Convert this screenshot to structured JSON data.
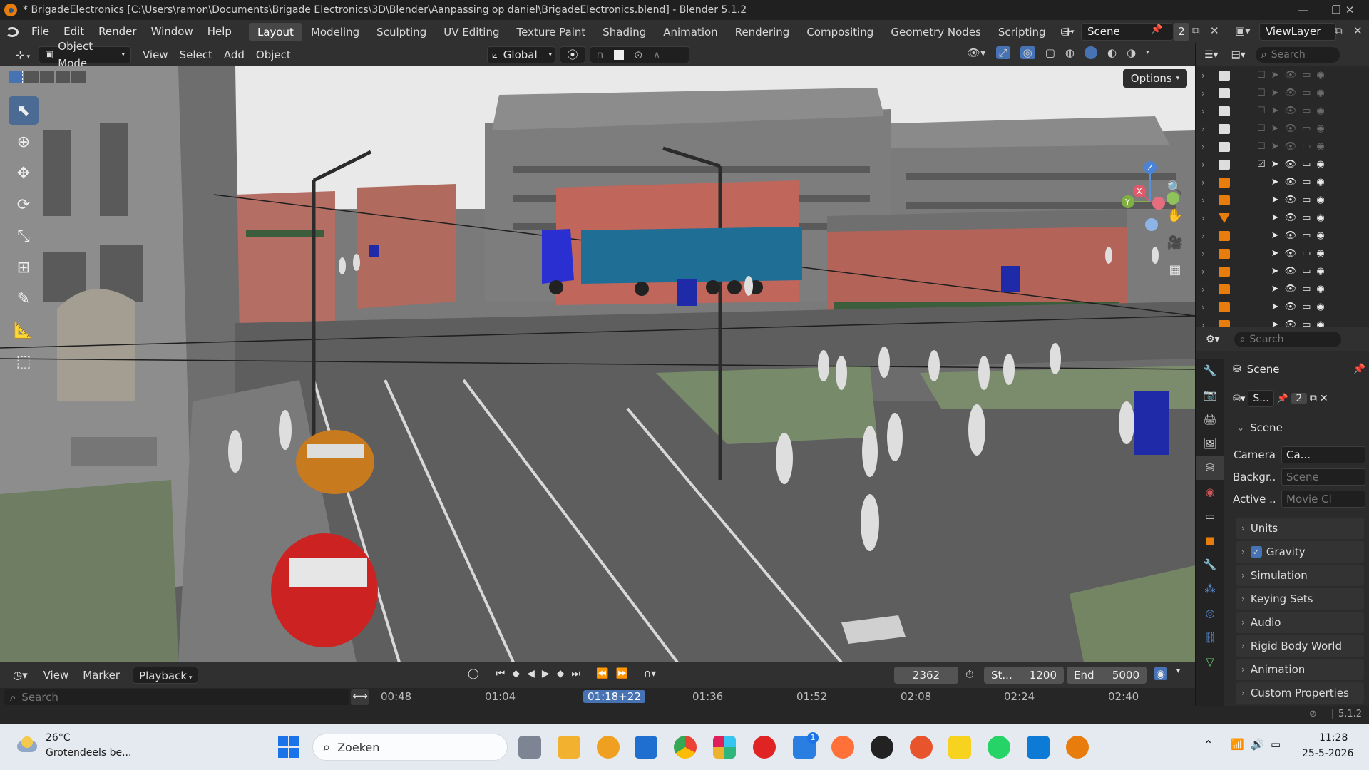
{
  "titlebar": {
    "title": "* BrigadeElectronics [C:\\Users\\ramon\\Documents\\Brigade Electronics\\3D\\Blender\\Aanpassing op daniel\\BrigadeElectronics.blend] - Blender 5.1.2",
    "minimize": "—",
    "maximize": "❐",
    "close": "✕"
  },
  "menubar": {
    "menus": [
      "File",
      "Edit",
      "Render",
      "Window",
      "Help"
    ],
    "workspaces": [
      "Layout",
      "Modeling",
      "Sculpting",
      "UV Editing",
      "Texture Paint",
      "Shading",
      "Animation",
      "Rendering",
      "Compositing",
      "Geometry Nodes",
      "Scripting"
    ],
    "active_workspace": "Layout",
    "add_workspace": "+",
    "scene_label": "Scene",
    "scene_users": "2",
    "viewlayer_label": "ViewLayer"
  },
  "viewport_header": {
    "mode": "Object Mode",
    "menus": [
      "View",
      "Select",
      "Add",
      "Object"
    ],
    "transform_orientation": "Global",
    "options_label": "Options"
  },
  "outliner": {
    "search_placeholder": "Search"
  },
  "properties": {
    "search_placeholder": "Search",
    "scene_title": "Scene",
    "scene_short": "S...",
    "scene_users": "2",
    "scene_panel": "Scene",
    "fields": [
      {
        "label": "Camera",
        "value": "Ca..."
      },
      {
        "label": "Backgr...",
        "value": "Scene"
      },
      {
        "label": "Active ...",
        "value": "Movie Cl"
      }
    ],
    "sections": [
      "Units",
      "Gravity",
      "Simulation",
      "Keying Sets",
      "Audio",
      "Rigid Body World",
      "Animation",
      "Custom Properties"
    ],
    "gravity_checked": true
  },
  "timeline": {
    "menus": [
      "View",
      "Marker"
    ],
    "playback": "Playback",
    "current_frame": "2362",
    "start_label": "St...",
    "start_value": "1200",
    "end_label": "End",
    "end_value": "5000",
    "search_placeholder": "Search",
    "ruler": [
      "00:48",
      "01:04",
      "01:18+22",
      "01:36",
      "01:52",
      "02:08",
      "02:24",
      "02:40"
    ],
    "current_time": "01:18+22"
  },
  "statusbar": {
    "version": "5.1.2"
  },
  "taskbar": {
    "weather_temp": "26°C",
    "weather_desc": "Grotendeels be...",
    "search_placeholder": "Zoeken",
    "time": "11:28",
    "date": "25-5-2026",
    "notification_badge": "1"
  },
  "colors": {
    "accent": "#4772b3",
    "blender_orange": "#e87d0d",
    "timeline_current": "#4772b3"
  }
}
